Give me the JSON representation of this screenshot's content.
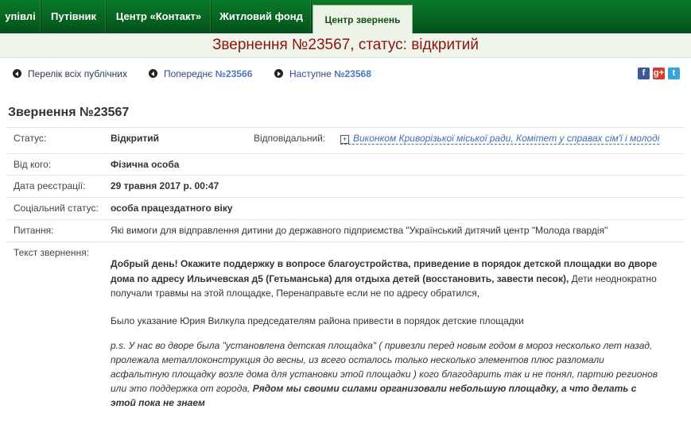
{
  "nav": {
    "tabs": [
      {
        "label": "упівлі"
      },
      {
        "label": "Путівник"
      },
      {
        "label": "Центр «Контакт»"
      },
      {
        "label": "Житловий фонд"
      },
      {
        "label": "Центр звернень",
        "active": true
      }
    ]
  },
  "page": {
    "title": "Звернення №23567, статус: відкритий",
    "heading": "Звернення №23567"
  },
  "links": {
    "list_all": "Перелік всіх публічних",
    "prev_label": "Попереднє",
    "prev_num": "№23566",
    "next_label": "Наступне",
    "next_num": "№23568"
  },
  "social": {
    "facebook": "f",
    "googleplus": "g+",
    "twitter": "t"
  },
  "details": {
    "status_label": "Статус:",
    "status_value": "Відкритий",
    "responsible_label": "Відповідальний:",
    "responsible_value": "Виконком Криворізької міської ради, Комітет у справах сім'ї і молоді",
    "from_label": "Від кого:",
    "from_value": "Фізична особа",
    "date_label": "Дата реєстрації:",
    "date_value": "29 травня 2017 р. 00:47",
    "social_label": "Соціальний статус:",
    "social_value": "особа працездатного віку",
    "question_label": "Питання:",
    "question_value": "Які вимоги для відправлення дитини до державного підприємства \"Український дитячий центр \"Молода гвардія\"",
    "text_label": "Текст звернення:"
  },
  "appeal": {
    "p1_bold": "Добрый день! Окажите поддержку в вопросе благоустройства, приведение в порядок детской площадки во дворе дома по адресу Ильичевская д5 (Гетьманська) для отдыха детей (восстановить, завести песок),",
    "p1_rest": " Дети неоднократно получали травмы на этой площадке, Перенаправьте если не по адресу обратился,",
    "p2": "Было указание Юрия Вилкула председателям района привести в порядок детские площадки",
    "p3_italic": "p.s. У нас во дворе была \"установлена детская площадка\" ( привезли перед новым годом в мороз несколько лет назад, пролежала металлоконструкция до весны, из всего осталось только несколько элементов плюс разломали асфальтную площадку возле дома для установки этой площадки ) кого благодарить так и не понял, партию регионов или это поддержка от города,",
    "p3_bold": " Рядом мы своими силами организовали небольшую площадку, а что делать с этой пока не знаем"
  },
  "colors": {
    "nav_green": "#0a7a2b",
    "title_red": "#8a1410",
    "status_red": "#cc2222",
    "link_blue": "#3f6cae"
  }
}
